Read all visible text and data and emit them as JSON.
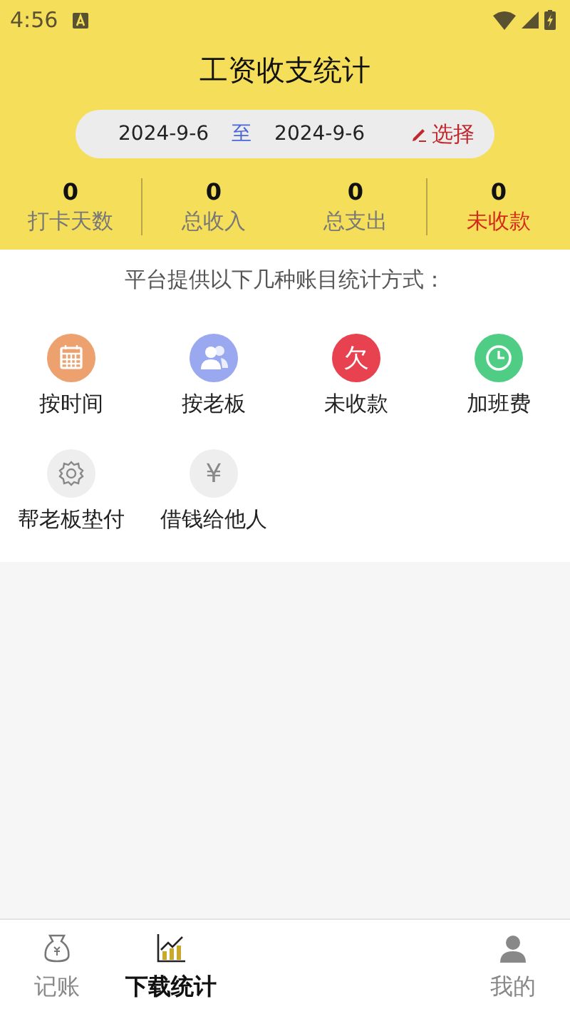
{
  "status_bar": {
    "time": "4:56"
  },
  "title": "工资收支统计",
  "date_range": {
    "start": "2024-9-6",
    "separator": "至",
    "end": "2024-9-6",
    "action": "选择"
  },
  "stats": [
    {
      "value": "0",
      "label": "打卡天数",
      "kind": "normal"
    },
    {
      "value": "0",
      "label": "总收入",
      "kind": "normal"
    },
    {
      "value": "0",
      "label": "总支出",
      "kind": "normal"
    },
    {
      "value": "0",
      "label": "未收款",
      "kind": "alert"
    }
  ],
  "intro": "平台提供以下几种账目统计方式：",
  "methods": [
    {
      "label": "按时间",
      "kind": "calendar"
    },
    {
      "label": "按老板",
      "kind": "people"
    },
    {
      "label": "未收款",
      "kind": "glyph-red",
      "glyph": "欠"
    },
    {
      "label": "加班费",
      "kind": "clock"
    },
    {
      "label": "帮老板垫付",
      "kind": "gear"
    },
    {
      "label": "借钱给他人",
      "kind": "glyph-grey",
      "glyph": "¥"
    }
  ],
  "tabs": [
    {
      "label": "记账",
      "kind": "moneybag",
      "selected": false
    },
    {
      "label": "下载统计",
      "kind": "chart",
      "selected": true
    },
    {
      "label": "我的",
      "kind": "person",
      "selected": false
    }
  ]
}
